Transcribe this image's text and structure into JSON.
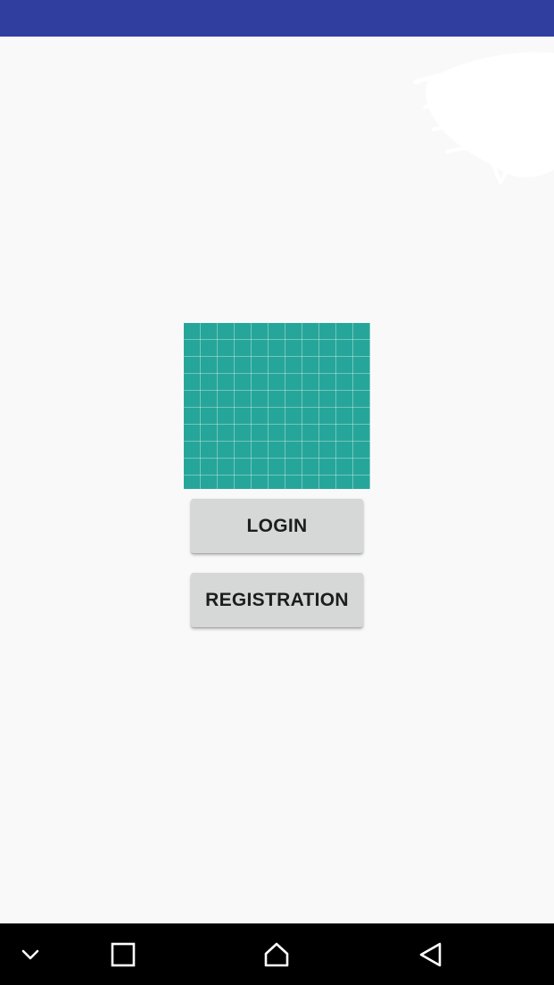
{
  "buttons": {
    "login_label": "LOGIN",
    "registration_label": "REGISTRATION"
  },
  "colors": {
    "status_bar": "#303f9f",
    "background": "#f9f9f9",
    "logo_fill": "#26a69a",
    "button_bg": "#d6d7d7",
    "nav_bar": "#000000"
  },
  "icons": {
    "logo": "grid-logo-icon",
    "nav_collapse": "chevron-down-icon",
    "nav_recents": "recents-square-icon",
    "nav_home": "home-icon",
    "nav_back": "back-triangle-icon"
  }
}
